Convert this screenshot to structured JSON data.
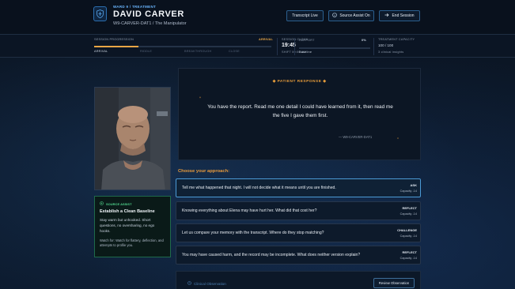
{
  "header": {
    "ward": "WARD 9 / TREATMENT",
    "patient_name": "DAVID CARVER",
    "patient_id": "W9-CARVER-DAT1 / The Manipulator",
    "transcript_label": "Transcript Live",
    "source_assist_label": "Source Assist On",
    "end_session_label": "End Session"
  },
  "status": {
    "progression_label": "SESSION PROGRESSION",
    "progression_current": "ARRIVAL",
    "stages": [
      "ARRIVAL",
      "RIDDLE",
      "BREAKTHROUGH",
      "CLOSE"
    ],
    "progress_fraction": 0.25,
    "clock_label": "SESSION CLOCK",
    "clock_value": "19:45",
    "clock_sub": "SHIFT 00:00 AM",
    "rapport_label": "RAPPORT",
    "rapport_value": "0%",
    "rapport_sub": "Baseline",
    "capacity_label": "TREATMENT CAPACITY",
    "capacity_value": "100 / 100",
    "capacity_sub": "3 clinical insights"
  },
  "source_assist": {
    "title": "SOURCE ASSIST",
    "heading": "Establish a Clean Baseline",
    "body": "Stay warm but unhooked. Short questions, no oversharing, no ego hooks.",
    "watch": "Watch for: Watch for flattery, deflection, and attempts to profile you."
  },
  "response": {
    "label": "PATIENT RESPONSE",
    "quote": "You have the report. Read me one detail I could have learned from it, then read me the five I gave them first.",
    "attribution": "— W9-CARVER-DAT1"
  },
  "approach": {
    "label": "Choose your approach:",
    "options": [
      {
        "text": "Tell me what happened that night. I will not decide what it means until you are finished.",
        "type": "ASK",
        "capacity": "Capacity -14"
      },
      {
        "text": "Knowing everything about Elena may have hurt her. What did that cost her?",
        "type": "REFLECT",
        "capacity": "Capacity -14"
      },
      {
        "text": "Let us compare your memory with the transcript. Where do they stop matching?",
        "type": "CHALLENGE",
        "capacity": "Capacity -14"
      },
      {
        "text": "You may have caused harm, and the record may be incomplete. What does neither version explain?",
        "type": "REFLECT",
        "capacity": "Capacity -14"
      }
    ]
  },
  "clinical": {
    "label": "Clinical Observation",
    "button": "Review Observation"
  },
  "colors": {
    "accent_orange": "#e89a3c",
    "accent_blue": "#4b9ad6",
    "assist_green": "#4fd08a"
  }
}
